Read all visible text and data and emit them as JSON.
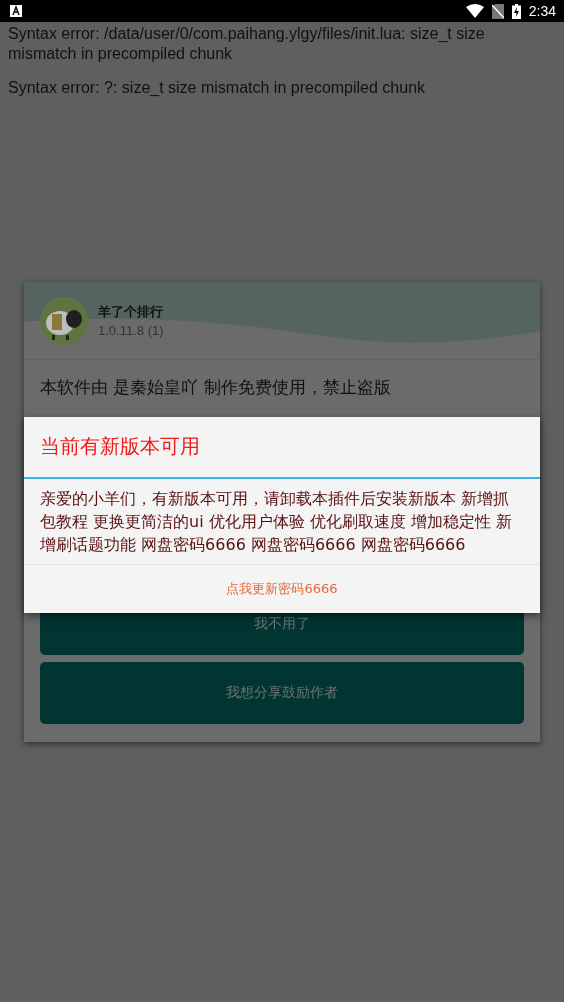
{
  "status_bar": {
    "time": "2:34"
  },
  "errors": [
    "Syntax error: /data/user/0/com.paihang.ylgy/files/init.lua: size_t size mismatch in precompiled chunk",
    "Syntax error: ?: size_t size mismatch in precompiled chunk"
  ],
  "app_dialog": {
    "app_name": "羊了个排行",
    "version": "1.0.11.8 (1)",
    "notice": "本软件由 是秦始皇吖 制作免费使用，禁止盗版",
    "buttons": [
      "我不用了",
      "我想分享鼓励作者"
    ]
  },
  "update_dialog": {
    "title": "当前有新版本可用",
    "message": "亲爱的小羊们，有新版本可用，请卸载本插件后安装新版本 新增抓包教程 更换更简洁的ui 优化用户体验 优化刷取速度 增加稳定性 新增刷话题功能 网盘密码6666 网盘密码6666 网盘密码6666",
    "button": "点我更新密码6666"
  }
}
